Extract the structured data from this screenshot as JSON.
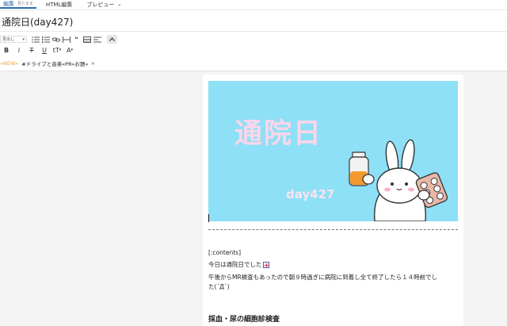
{
  "tabs": {
    "edit_label": "編集",
    "edit_sub": "見たまま",
    "html_label": "HTML編集",
    "preview_label": "プレビュー"
  },
  "post": {
    "title": "通院日(day427)"
  },
  "toolbar": {
    "block_format": "見出し",
    "bold": "B",
    "italic": "i",
    "strike": "T",
    "underline": "U",
    "font_size": "tT",
    "font_color": "A",
    "quote": "❝"
  },
  "tags": {
    "new_label": "«NEW»",
    "tag": "#ドライブと音楽«PR»お題«",
    "remove": "×"
  },
  "eyecatch": {
    "heading": "通院日",
    "day": "day427",
    "background": "#8ee0f6",
    "text_color": "#fbd6ea"
  },
  "content": {
    "contents_tag": "[:contents]",
    "line1": "今日は通院日でした",
    "line2": "午後からMR検査もあったので朝９時過ぎに病院に到着し全て終了したら１４時前でし",
    "line3": "た(´Д`)",
    "heading": "採血・尿の細胞診検査",
    "hospital_icon": "hospital-icon"
  },
  "colors": {
    "accent": "#2b6cb0",
    "new_badge": "#e8a33a"
  }
}
